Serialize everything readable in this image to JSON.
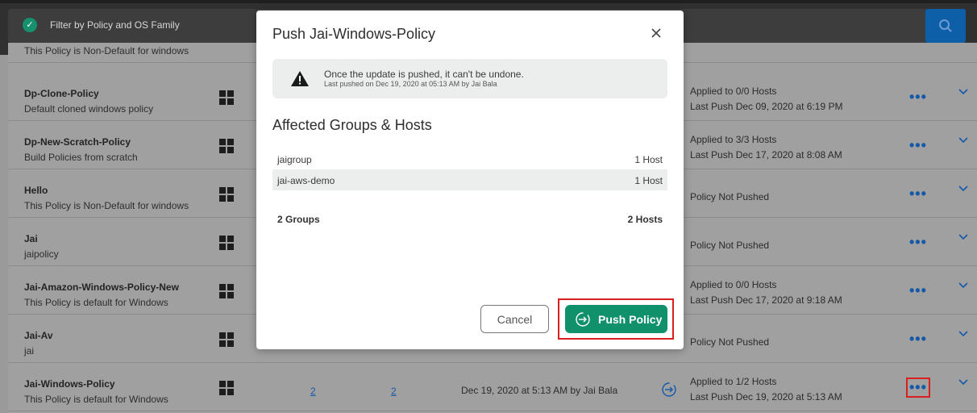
{
  "filter": {
    "label": "Filter by Policy and OS Family"
  },
  "rows": [
    {
      "desc": "This Policy is Non-Default for windows"
    },
    {
      "name": "Dp-Clone-Policy",
      "desc": "Default cloned windows policy",
      "status1": "Applied to 0/0 Hosts",
      "status2": "Last Push Dec 09, 2020 at 6:19 PM"
    },
    {
      "name": "Dp-New-Scratch-Policy",
      "desc": "Build Policies from scratch",
      "status1": "Applied to 3/3 Hosts",
      "status2": "Last Push Dec 17, 2020 at 8:08 AM"
    },
    {
      "name": "Hello",
      "desc": "This Policy is Non-Default for windows",
      "status": "Policy Not Pushed"
    },
    {
      "name": "Jai",
      "desc": "jaipolicy",
      "status": "Policy Not Pushed"
    },
    {
      "name": "Jai-Amazon-Windows-Policy-New",
      "desc": "This Policy is default for Windows",
      "status1": "Applied to 0/0 Hosts",
      "status2": "Last Push Dec 17, 2020 at 9:18 AM"
    },
    {
      "name": "Jai-Av",
      "desc": "jai",
      "status": "Policy Not Pushed"
    },
    {
      "name": "Jai-Windows-Policy",
      "desc": "This Policy is default for Windows",
      "groups": "2",
      "hosts": "2",
      "date": "Dec 19, 2020 at 5:13 AM by Jai Bala",
      "status1": "Applied to 1/2 Hosts",
      "status2": "Last Push Dec 19, 2020 at 5:13 AM"
    }
  ],
  "more_label": "•••",
  "modal": {
    "title": "Push Jai-Windows-Policy",
    "warning_main": "Once the update is pushed, it can't be undone.",
    "warning_sub": "Last pushed on Dec 19, 2020 at 05:13 AM by Jai Bala",
    "section_title": "Affected Groups & Hosts",
    "groups": [
      {
        "name": "jaigroup",
        "hosts": "1 Host"
      },
      {
        "name": "jai-aws-demo",
        "hosts": "1 Host"
      }
    ],
    "total_groups": "2 Groups",
    "total_hosts": "2 Hosts",
    "cancel_label": "Cancel",
    "push_label": "Push Policy"
  },
  "colors": {
    "accent": "#10916c",
    "link": "#1458a8",
    "highlight": "#d92020",
    "topbar": "#303030"
  },
  "icons": [
    "check-icon",
    "search-icon",
    "windows-icon",
    "more-icon",
    "chevron-down-icon",
    "push-icon",
    "warning-icon",
    "close-icon"
  ]
}
